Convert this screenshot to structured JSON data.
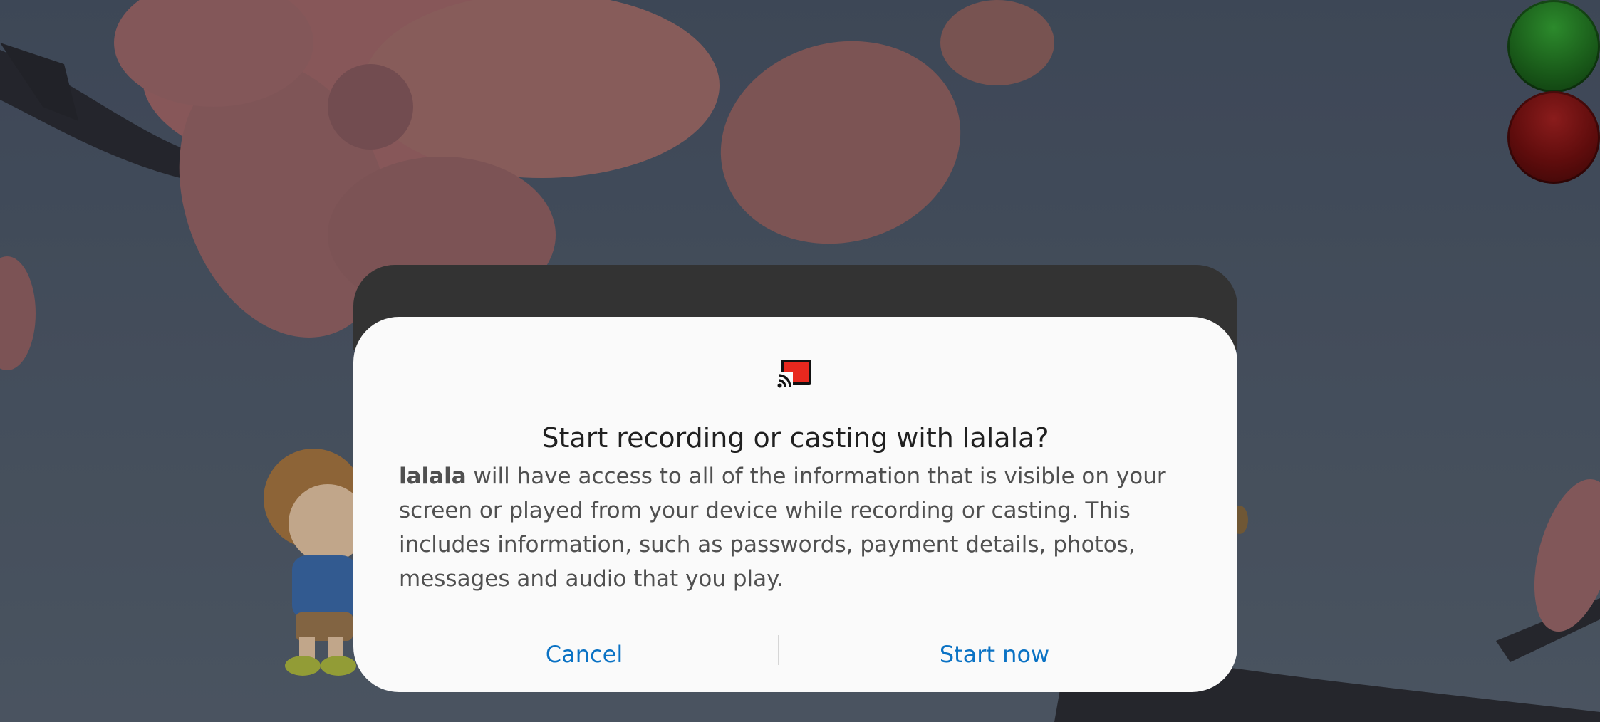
{
  "dialog": {
    "icon": "screen-cast-icon",
    "title": "Start recording or casting with lalala?",
    "message_app_name": "lalala",
    "message_text": " will have access to all of the information that is visible on your screen or played from your device while recording or casting. This includes information, such as passwords, payment details, photos, messages and audio that you play.",
    "cancel_label": "Cancel",
    "start_label": "Start now"
  },
  "background": {
    "orbs": [
      "green-button",
      "red-button"
    ]
  },
  "colors": {
    "accent": "#0a72c4",
    "dialog_background": "#fafafa",
    "cast_icon_red": "#e8281e"
  }
}
